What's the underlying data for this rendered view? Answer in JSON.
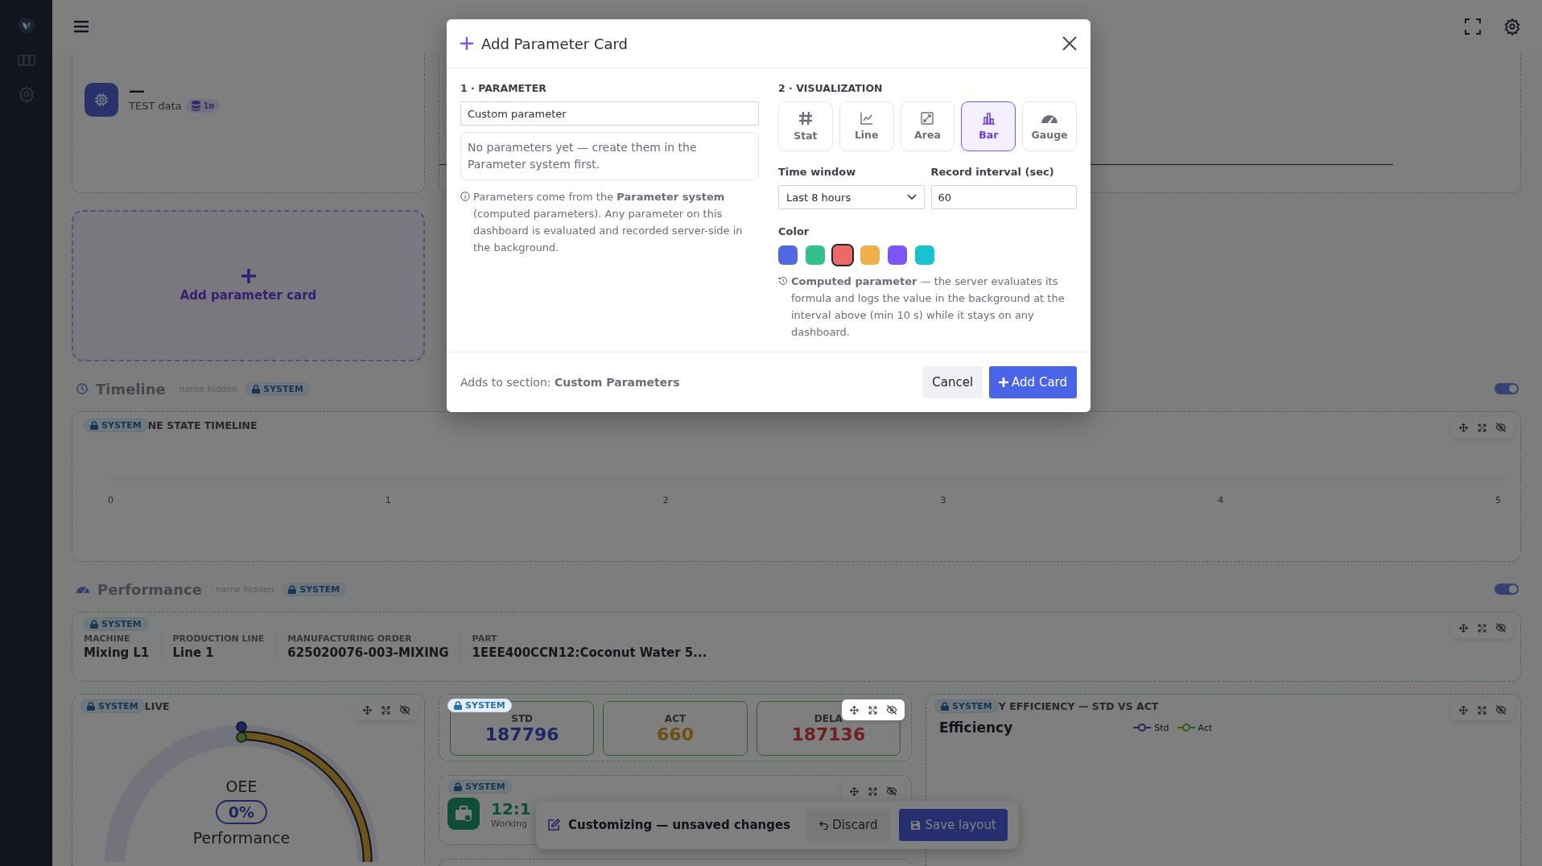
{
  "top_card": {
    "value": "—",
    "label": "TEST data",
    "badge": "1m"
  },
  "add_card": {
    "label": "Add parameter card"
  },
  "sections": [
    {
      "title": "Timeline",
      "note": "· name hidden",
      "badge": "SYSTEM",
      "on": true
    },
    {
      "title": "Performance",
      "note": "· name hidden",
      "badge": "SYSTEM",
      "on": true
    }
  ],
  "timeline": {
    "badge": "SYSTEM",
    "title": "NE STATE TIMELINE",
    "x_labels": [
      "0",
      "1",
      "2",
      "3",
      "4",
      "5"
    ]
  },
  "info_card": {
    "badge": "SYSTEM",
    "fields": [
      {
        "label": "MACHINE",
        "value": "Mixing L1"
      },
      {
        "label": "PRODUCTION LINE",
        "value": "Line 1"
      },
      {
        "label": "MANUFACTURING ORDER",
        "value": "625020076-003-MIXING"
      },
      {
        "label": "PART",
        "value": "1EEE400CCN12:Coconut Water 5..."
      }
    ]
  },
  "live_card": {
    "badge": "SYSTEM",
    "title": "LIVE",
    "gauge_label": "OEE",
    "gauge_value": "0%",
    "sub_label": "Performance"
  },
  "stats_card": {
    "badge": "SYSTEM",
    "stats": [
      {
        "kind": "standard",
        "label": "STD",
        "value": "187796"
      },
      {
        "kind": "actual",
        "label": "ACT",
        "value": "660"
      },
      {
        "kind": "delay",
        "label": "DELA",
        "value": "187136"
      }
    ]
  },
  "clock_card": {
    "badge": "SYSTEM",
    "time": "12:1",
    "status": "Working"
  },
  "efficiency_card": {
    "badge": "SYSTEM",
    "title": "Y EFFICIENCY — STD VS ACT",
    "heading": "Efficiency",
    "legend": [
      {
        "name": "Std",
        "color": "#1f2862"
      },
      {
        "name": "Act",
        "color": "#2e5c17"
      }
    ]
  },
  "customize_bar": {
    "message": "Customizing — unsaved changes",
    "discard": "Discard",
    "save": "Save layout"
  },
  "modal": {
    "title": "Add Parameter Card",
    "section_1": "1 · PARAMETER",
    "parameter_field": {
      "value": "Custom parameter"
    },
    "empty_message": "No parameters yet — create them in the Parameter system first.",
    "info": "Parameters come from the **Parameter system** (computed parameters). Any parameter on this dashboard is evaluated and recorded server-side in the background.",
    "section_2": "2 · VISUALIZATION",
    "viz_types": [
      {
        "kind": "stat",
        "label": "Stat",
        "selected": false
      },
      {
        "kind": "line",
        "label": "Line",
        "selected": false
      },
      {
        "kind": "area",
        "label": "Area",
        "selected": false
      },
      {
        "kind": "bar",
        "label": "Bar",
        "selected": true
      },
      {
        "kind": "gauge",
        "label": "Gauge",
        "selected": false
      }
    ],
    "time_window": {
      "label": "Time window",
      "value": "Last 8 hours"
    },
    "record_interval": {
      "label": "Record interval (sec)",
      "value": "60"
    },
    "color_label": "Color",
    "colors": [
      {
        "color": "#5069e0",
        "selected": false
      },
      {
        "color": "#33c08a",
        "selected": false
      },
      {
        "color": "#ef6767",
        "selected": true
      },
      {
        "color": "#f0b048",
        "selected": false
      },
      {
        "color": "#7b55f5",
        "selected": false
      },
      {
        "color": "#17c2d1",
        "selected": false
      }
    ],
    "computed_note": "**Computed parameter** — the server evaluates its formula and logs the value in the background at the interval above (min 10 s) while it stays on any dashboard.",
    "footer": "Adds to section: **Custom Parameters**",
    "cancel": "Cancel",
    "add": "Add Card"
  }
}
